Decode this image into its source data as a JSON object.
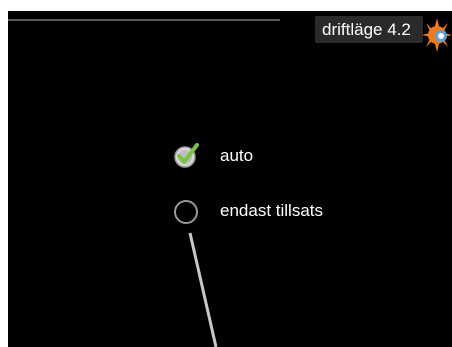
{
  "header": {
    "title": "driftläge 4.2",
    "mode_icon": "sun-heat-icon"
  },
  "options": [
    {
      "label": "auto",
      "selected": true,
      "icon": "checkmark-icon"
    },
    {
      "label": "endast tillsats",
      "selected": false,
      "icon": "empty-radio-icon"
    }
  ],
  "colors": {
    "background": "#000000",
    "text": "#ffffff",
    "check_green": "#7cc242",
    "title_bg": "#2a2a2a",
    "icon_orange": "#f07a1a"
  }
}
